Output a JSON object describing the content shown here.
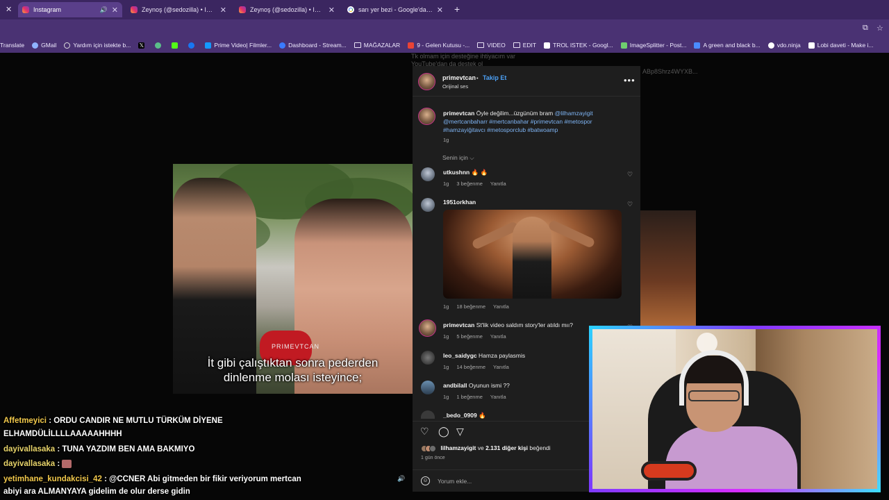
{
  "browser": {
    "tabs": [
      {
        "label": "Instagram",
        "icon": "instagram-icon",
        "active": true
      },
      {
        "label": "Zeynoş (@sedozilla) • Instagram",
        "icon": "instagram-icon",
        "active": false
      },
      {
        "label": "Zeynoş (@sedozilla) • Instagram",
        "icon": "instagram-icon",
        "active": false
      },
      {
        "label": "sarı yer bezi - Google'da Ara",
        "icon": "google-icon",
        "active": false
      }
    ],
    "bookmarks": [
      "Translate",
      "GMail",
      "Yardım için istekte b...",
      "",
      "",
      "",
      "",
      "Prime Video| Filmler...",
      "Dashboard - Stream...",
      "MAĞAZALAR",
      "9 - Gelen Kutusu -...",
      "VIDEO",
      "EDIT",
      "TROL ISTEK - Googl...",
      "ImageSplitter - Post...",
      "A green and black b...",
      "vdo.ninja",
      "Lobi daveti - Make i..."
    ],
    "colors": {
      "tabbar": "#3b2660",
      "toolbar": "#4a3273"
    }
  },
  "background": {
    "text_top": "Tk olmam için desteğine ihtiyacım var",
    "text_top2": "YouTube'dan da destek ol",
    "text_right": "ABp8Shrz4WYXB..."
  },
  "video": {
    "watermark": "PRIMEVTCAN",
    "caption_line1": "İt gibi çalıştıktan sonra pederden",
    "caption_line2": "dinlenme molası isteyince;"
  },
  "instagram": {
    "header": {
      "username": "primevtcan",
      "separator": "•",
      "follow_label": "Takip Et",
      "audio": "Orijinal ses"
    },
    "caption": {
      "username": "primevtcan",
      "text": " Öyle değilim...üzgünüm bram ",
      "tags": "@lilhamzayigit @mertcanbaharr #mertcanbahar #primevtcan #metospor #hamzayiğitavcı #metosporclub #batwoamp",
      "time": "1g"
    },
    "sort_label": "Senin için",
    "comments": [
      {
        "user": "utkushnn",
        "text": " 🔥 🔥",
        "time": "1g",
        "likes": "3 beğenme",
        "reply": "Yanıtla"
      },
      {
        "user": "1951orkhan",
        "text": "",
        "time": "1g",
        "likes": "18 beğenme",
        "reply": "Yanıtla"
      },
      {
        "user": "primevtcan",
        "text": " St'lik video saldım story'ler atıldı mıı?",
        "time": "1g",
        "likes": "5 beğenme",
        "reply": "Yanıtla"
      },
      {
        "user": "leo_saidygc",
        "text": " Hamza paylasmis",
        "time": "1g",
        "likes": "14 beğenme",
        "reply": "Yanıtla"
      },
      {
        "user": "andbilall",
        "text": " Oyunun ismi ??",
        "time": "1g",
        "likes": "1 beğenme",
        "reply": "Yanıtla"
      },
      {
        "user": "_bedo_0909",
        "text": " 🔥",
        "time": "",
        "likes": "",
        "reply": ""
      }
    ],
    "likes": {
      "user": "lilhamzayigit",
      "rest": " ve ",
      "count": "2.131 diğer kişi",
      "suffix": " beğendi"
    },
    "posted_ago": "1 gün önce",
    "comment_placeholder": "Yorum ekle..."
  },
  "chat": [
    {
      "user": "Affetmeyici",
      "text": " : ORDU CANDIR NE MUTLU TÜRKÜM DİYENE"
    },
    {
      "user": "",
      "text": "ELHAMDÜLİLLLLAAAAAHHHH"
    },
    {
      "user": "dayivallasaka",
      "text": " : TUNA YAZDIM BEN AMA BAKMIYO"
    },
    {
      "user": "dayivallasaka",
      "text": " : "
    },
    {
      "user": "yetimhane_kundakcisi_42",
      "text": " : @CCNER Abi gitmeden bir fikir veriyorum mertcan"
    },
    {
      "user": "",
      "text": "abiyi ara ALMANYAYA gidelim de olur derse gidin"
    }
  ]
}
